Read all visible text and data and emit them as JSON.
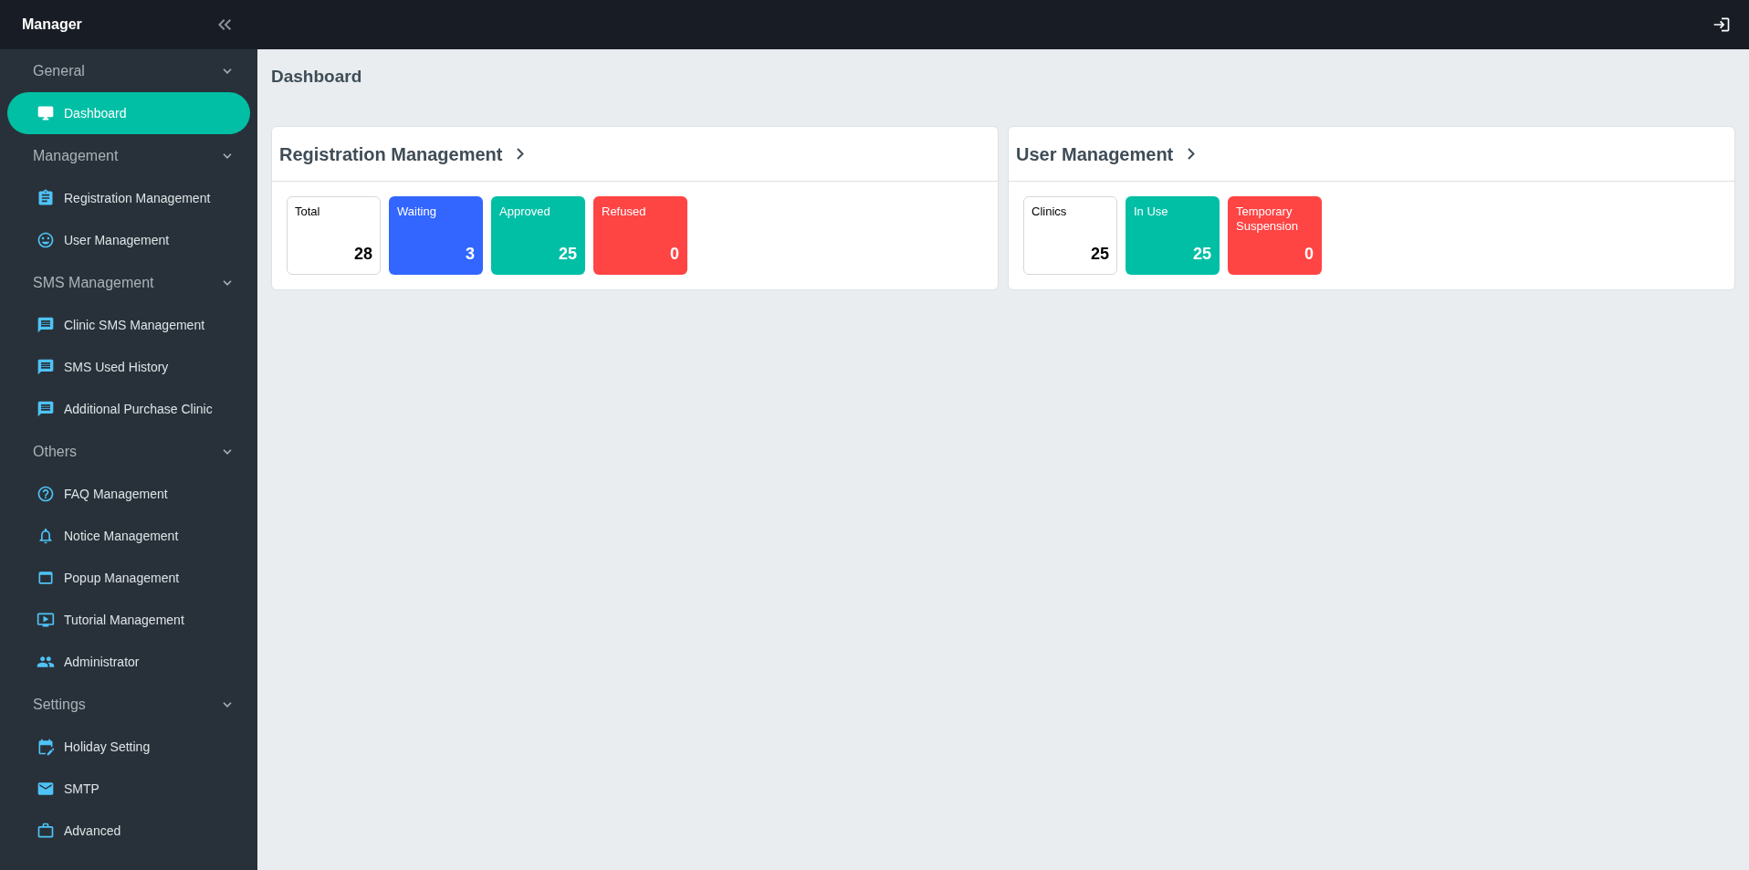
{
  "sidebar": {
    "title": "Manager",
    "sections": [
      {
        "label": "General",
        "expanded": true,
        "items": [
          {
            "label": "Dashboard",
            "selected": true
          }
        ]
      },
      {
        "label": "Management",
        "expanded": true,
        "items": [
          {
            "label": "Registration Management",
            "selected": false
          },
          {
            "label": "User Management",
            "selected": false
          }
        ]
      },
      {
        "label": "SMS Management",
        "expanded": true,
        "items": [
          {
            "label": "Clinic SMS Management",
            "selected": false
          },
          {
            "label": "SMS Used History",
            "selected": false
          },
          {
            "label": "Additional Purchase Clinic",
            "selected": false
          }
        ]
      },
      {
        "label": "Others",
        "expanded": true,
        "items": [
          {
            "label": "FAQ Management",
            "selected": false
          },
          {
            "label": "Notice Management",
            "selected": false
          },
          {
            "label": "Popup Management",
            "selected": false
          },
          {
            "label": "Tutorial Management",
            "selected": false
          },
          {
            "label": "Administrator",
            "selected": false
          }
        ]
      },
      {
        "label": "Settings",
        "expanded": true,
        "items": [
          {
            "label": "Holiday Setting",
            "selected": false
          },
          {
            "label": "SMTP",
            "selected": false
          },
          {
            "label": "Advanced",
            "selected": false
          }
        ]
      }
    ]
  },
  "page_title": "Dashboard",
  "panels": [
    {
      "title": "Registration Management",
      "stats": [
        {
          "label": "Total",
          "value": "28",
          "color": "#ffffff"
        },
        {
          "label": "Waiting",
          "value": "3",
          "color": "#3366ff"
        },
        {
          "label": "Approved",
          "value": "25",
          "color": "#00bfa5"
        },
        {
          "label": "Refused",
          "value": "0",
          "color": "#ff4444"
        }
      ]
    },
    {
      "title": "User Management",
      "stats": [
        {
          "label": "Clinics",
          "value": "25",
          "color": "#ffffff"
        },
        {
          "label": "In Use",
          "value": "25",
          "color": "#00bfa5"
        },
        {
          "label": "Temporary Suspension",
          "value": "0",
          "color": "#ff4444"
        }
      ]
    }
  ]
}
